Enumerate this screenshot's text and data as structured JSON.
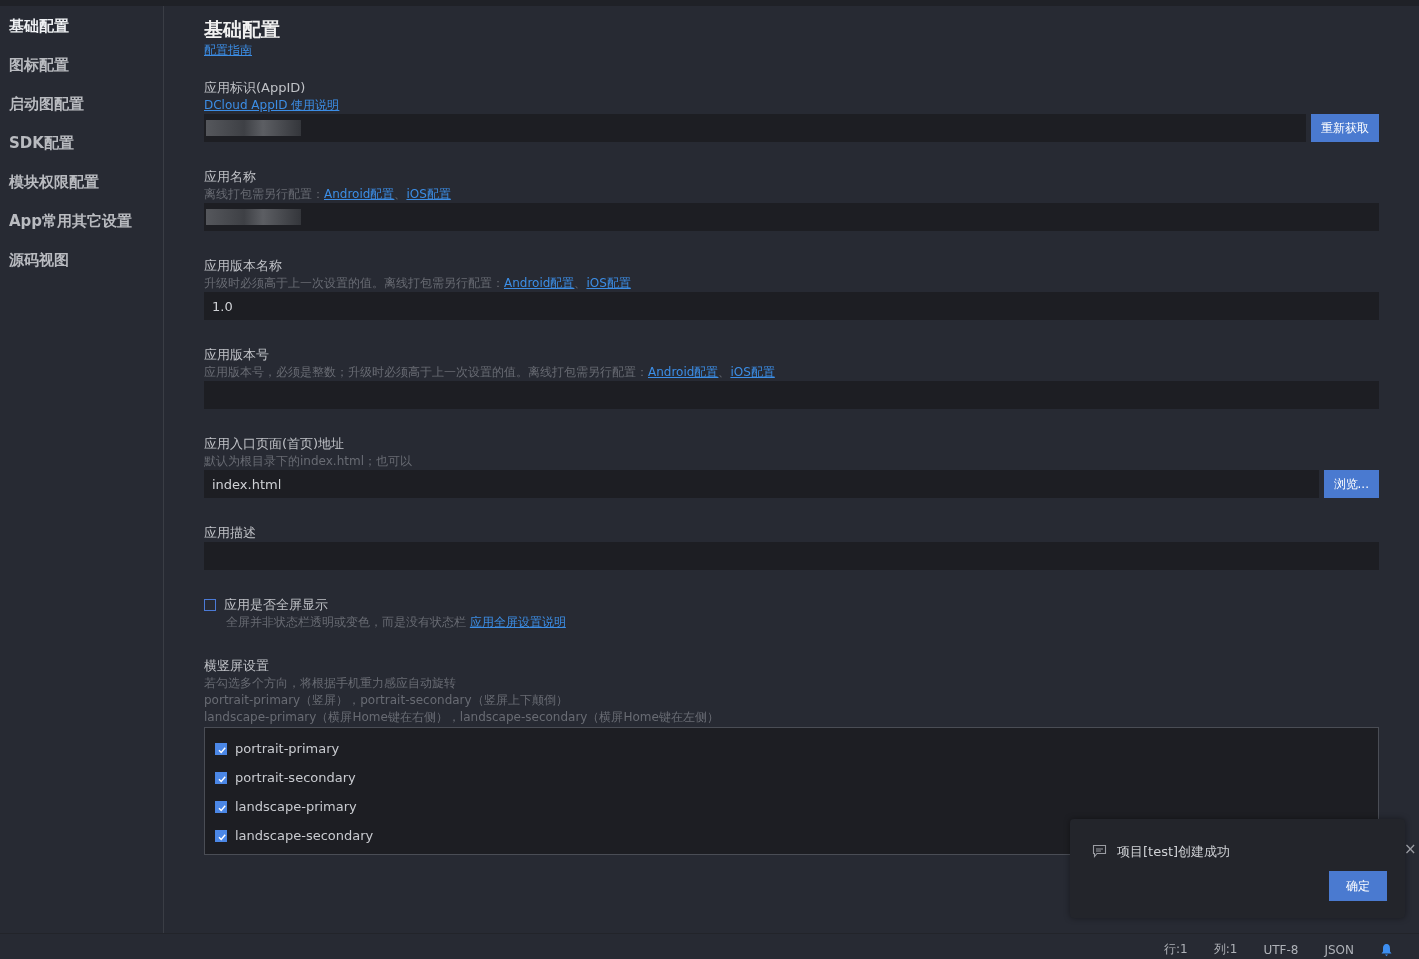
{
  "sidebar": {
    "items": [
      {
        "label": "基础配置",
        "selected": true
      },
      {
        "label": "图标配置",
        "selected": false
      },
      {
        "label": "启动图配置",
        "selected": false
      },
      {
        "label": "SDK配置",
        "selected": false
      },
      {
        "label": "模块权限配置",
        "selected": false
      },
      {
        "label": "App常用其它设置",
        "selected": false
      },
      {
        "label": "源码视图",
        "selected": false
      }
    ]
  },
  "header": {
    "title": "基础配置",
    "link": "配置指南"
  },
  "fields": [
    {
      "kind": "input",
      "label": "应用标识(AppID)",
      "hint": [
        {
          "kind": "link",
          "text": "DCloud AppID 使用说明"
        }
      ],
      "redacted": true,
      "button": "重新获取"
    },
    {
      "kind": "input",
      "label": "应用名称",
      "hint": [
        {
          "kind": "plain",
          "text": "离线打包需另行配置："
        },
        {
          "kind": "link",
          "text": "Android配置"
        },
        {
          "kind": "plain",
          "text": "、"
        },
        {
          "kind": "link",
          "text": "iOS配置"
        }
      ],
      "redacted": true
    },
    {
      "kind": "input",
      "label": "应用版本名称",
      "hint": [
        {
          "kind": "plain",
          "text": "升级时必须高于上一次设置的值。离线打包需另行配置："
        },
        {
          "kind": "link",
          "text": "Android配置"
        },
        {
          "kind": "plain",
          "text": "、"
        },
        {
          "kind": "link",
          "text": "iOS配置"
        }
      ],
      "value": "1.0"
    },
    {
      "kind": "input",
      "label": "应用版本号",
      "hint": [
        {
          "kind": "plain",
          "text": "应用版本号，必须是整数；升级时必须高于上一次设置的值。离线打包需另行配置："
        },
        {
          "kind": "link",
          "text": "Android配置"
        },
        {
          "kind": "plain",
          "text": "、"
        },
        {
          "kind": "link",
          "text": "iOS配置"
        }
      ]
    },
    {
      "kind": "input",
      "label": "应用入口页面(首页)地址",
      "hint": [
        {
          "kind": "plain",
          "text": "默认为根目录下的index.html；也可以"
        }
      ],
      "value": "index.html",
      "button": "浏览..."
    },
    {
      "kind": "input",
      "label": "应用描述"
    },
    {
      "kind": "checkbox",
      "label": "应用是否全屏显示",
      "checked": false,
      "hint": [
        {
          "kind": "plain",
          "text": "全屏并非状态栏透明或变色，而是没有状态栏 "
        },
        {
          "kind": "link",
          "text": "应用全屏设置说明"
        }
      ]
    },
    {
      "kind": "checklist",
      "label": "横竖屏设置",
      "lines": [
        "若勾选多个方向，将根据手机重力感应自动旋转",
        "portrait-primary（竖屏），portrait-secondary（竖屏上下颠倒）",
        "landscape-primary（横屏Home键在右侧），landscape-secondary（横屏Home键在左侧）"
      ],
      "options": [
        {
          "label": "portrait-primary",
          "checked": true
        },
        {
          "label": "portrait-secondary",
          "checked": true
        },
        {
          "label": "landscape-primary",
          "checked": true
        },
        {
          "label": "landscape-secondary",
          "checked": true
        }
      ]
    }
  ],
  "toast": {
    "message": "项目[test]创建成功",
    "button": "确定",
    "close": "×"
  },
  "status_bar": {
    "items": [
      "行:1",
      "列:1",
      "UTF-8",
      "JSON"
    ]
  }
}
